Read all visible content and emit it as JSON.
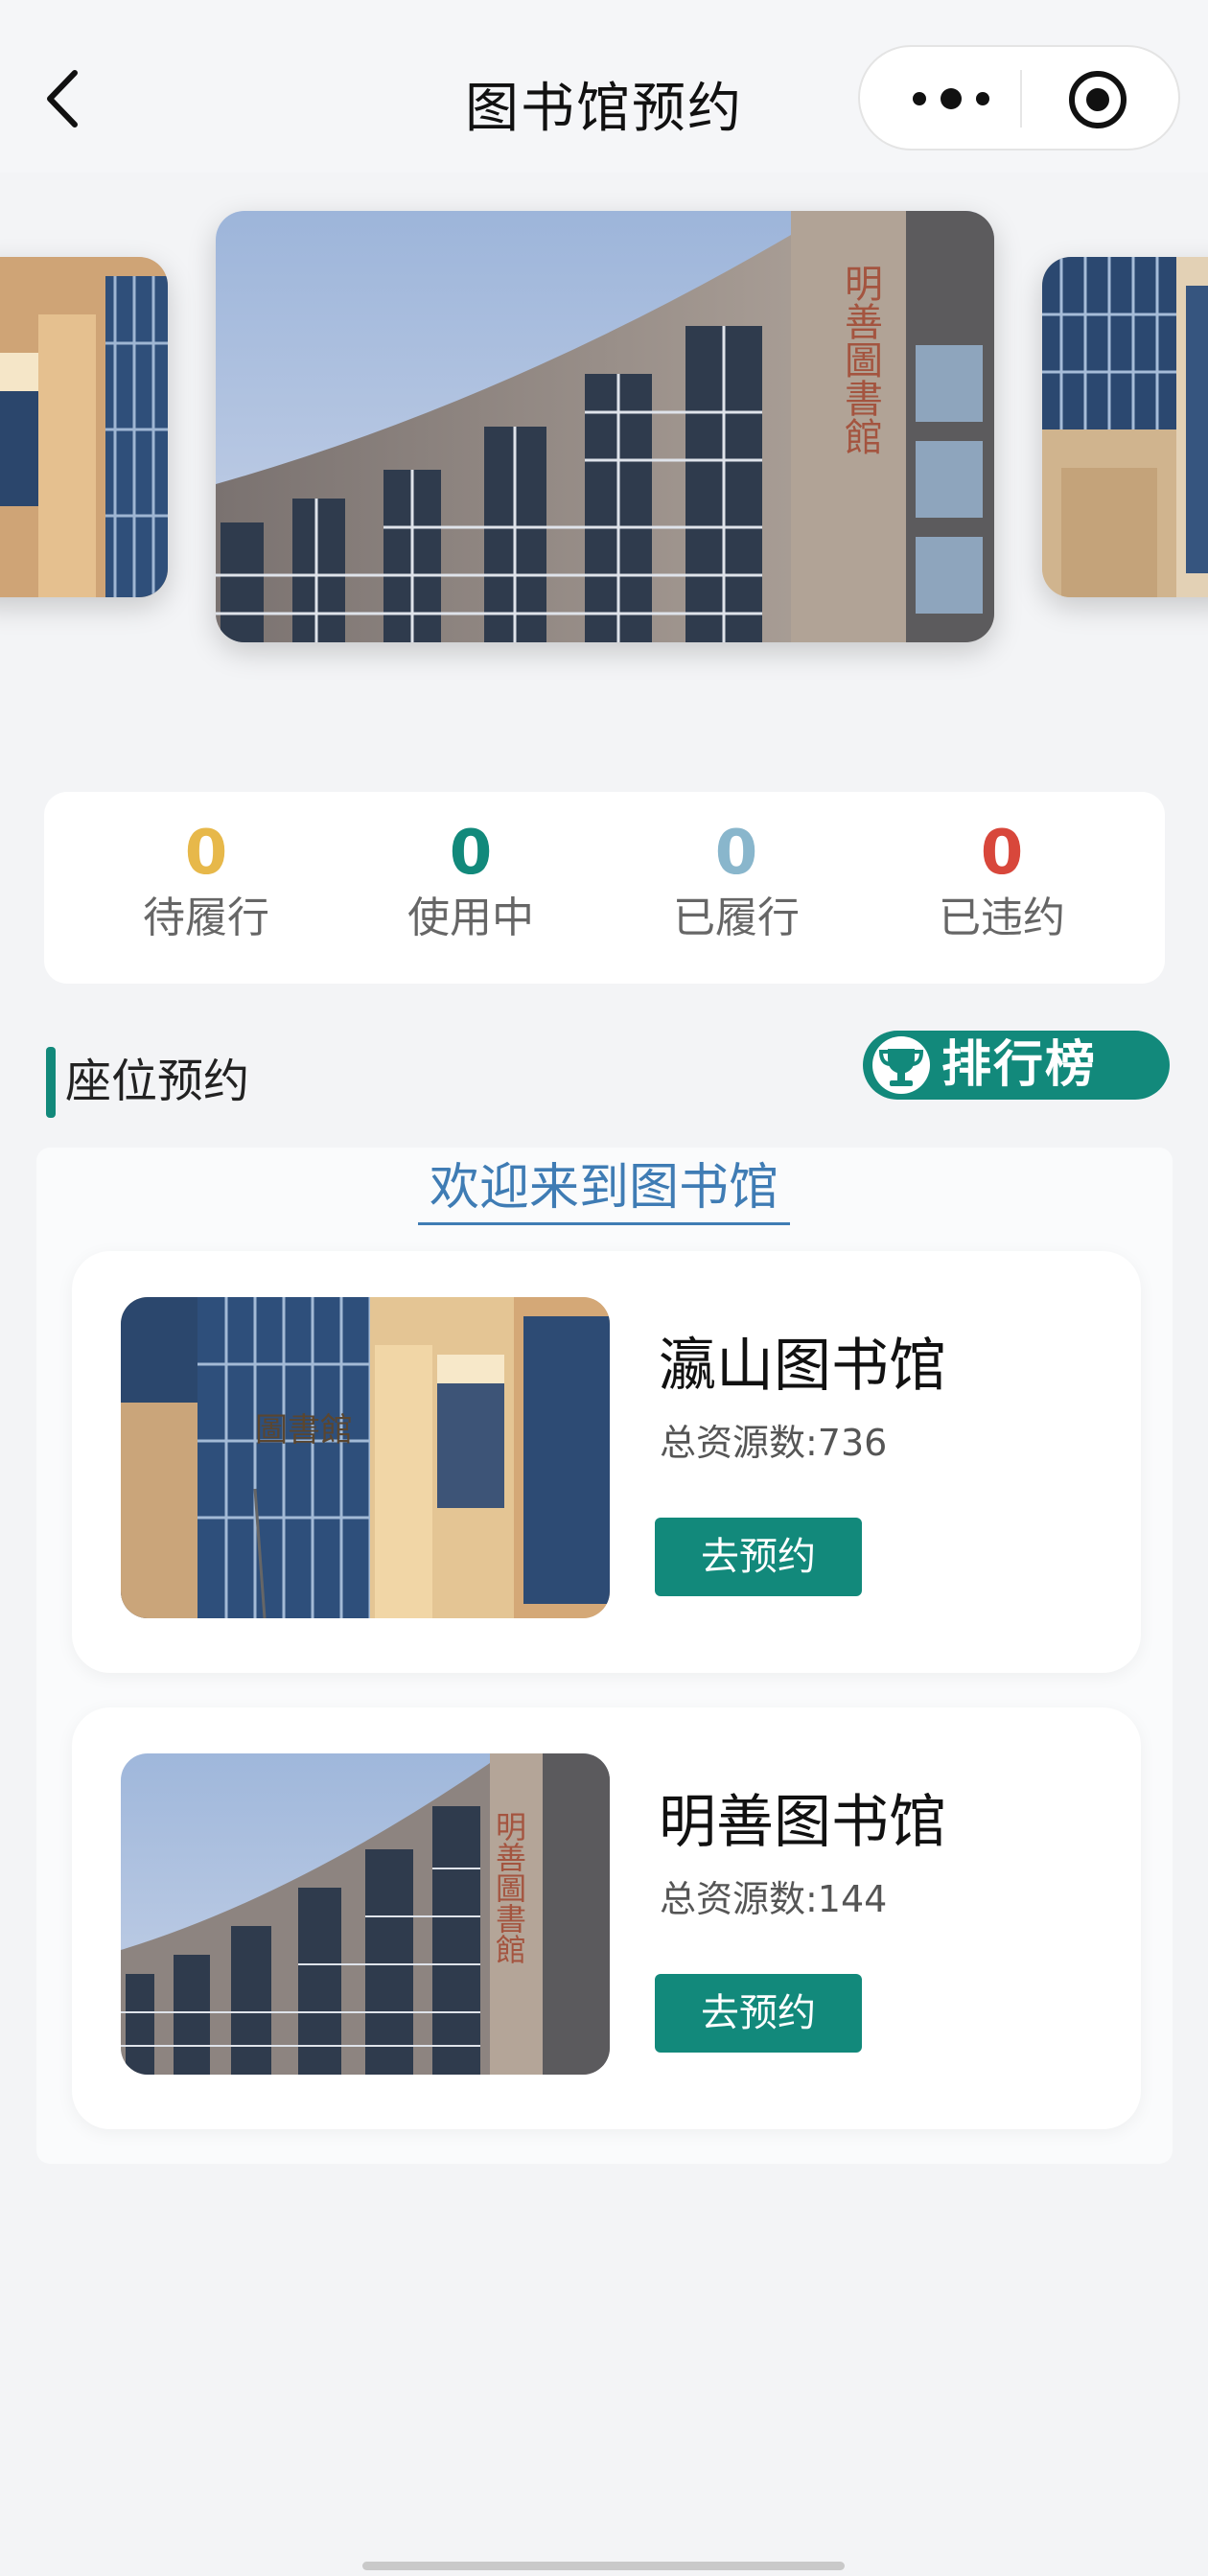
{
  "nav": {
    "title": "图书馆预约"
  },
  "carousel": {
    "slide_count": 4,
    "active_index": 0,
    "main_sign": "明善圖書館"
  },
  "stats": [
    {
      "value": "0",
      "label": "待履行",
      "color": "#e7b84a"
    },
    {
      "value": "0",
      "label": "使用中",
      "color": "#12897b"
    },
    {
      "value": "0",
      "label": "已履行",
      "color": "#89b6cc"
    },
    {
      "value": "0",
      "label": "已违约",
      "color": "#d8473b"
    }
  ],
  "section": {
    "title": "座位预约",
    "rank_label": "排行榜"
  },
  "welcome": "欢迎来到图书馆",
  "libraries": [
    {
      "name": "瀛山图书馆",
      "total": "总资源数:736",
      "button": "去预约",
      "photo_sign": "圖書館"
    },
    {
      "name": "明善图书馆",
      "total": "总资源数:144",
      "button": "去预约",
      "photo_sign": "明善圖書館"
    }
  ],
  "colors": {
    "accent": "#12897b",
    "link": "#3f7cb4"
  }
}
